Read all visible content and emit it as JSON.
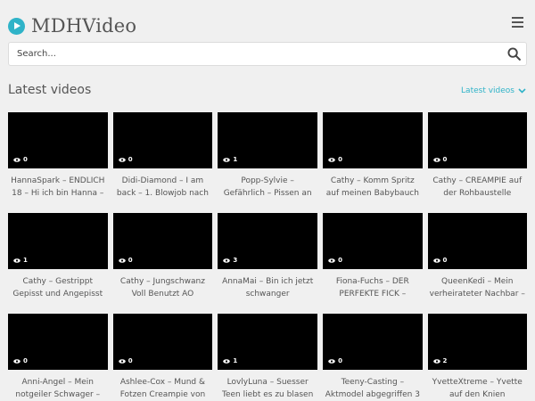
{
  "site": {
    "name": "MDHVideo"
  },
  "search": {
    "placeholder": "Search..."
  },
  "section": {
    "title": "Latest videos",
    "sort_label": "Latest videos"
  },
  "colors": {
    "accent": "#2fb3c8",
    "thumb_bg": "#000000"
  },
  "videos": [
    {
      "title": "HannaSpark – ENDLICH 18 – Hi ich bin Hanna –",
      "views": "0"
    },
    {
      "title": "Didi-Diamond – I am back – 1. Blowjob nach",
      "views": "0"
    },
    {
      "title": "Popp-Sylvie – Gefährlich – Pissen an der Strasse",
      "views": "1"
    },
    {
      "title": "Cathy – Komm Spritz auf meinen Babybauch",
      "views": "0"
    },
    {
      "title": "Cathy – CREAMPIE auf der Rohbaustelle",
      "views": "0"
    },
    {
      "title": "Cathy – Gestrippt Gepisst und Angepisst",
      "views": "1"
    },
    {
      "title": "Cathy – Jungschwanz Voll Benutzt AO",
      "views": "0"
    },
    {
      "title": "AnnaMai – Bin ich jetzt schwanger",
      "views": "3"
    },
    {
      "title": "Fiona-Fuchs – DER PERFEKTE FICK –",
      "views": "0"
    },
    {
      "title": "QueenKedi – Mein verheirateter Nachbar –",
      "views": "0"
    },
    {
      "title": "Anni-Angel – Mein notgeiler Schwager –",
      "views": "0"
    },
    {
      "title": "Ashlee-Cox – Mund & Fotzen Creampie von",
      "views": "0"
    },
    {
      "title": "LovlyLuna – Suesser Teen liebt es zu blasen",
      "views": "1"
    },
    {
      "title": "Teeny-Casting – Aktmodel abgegriffen 3",
      "views": "0"
    },
    {
      "title": "YvetteXtreme – Yvette auf den Knien",
      "views": "2"
    }
  ]
}
